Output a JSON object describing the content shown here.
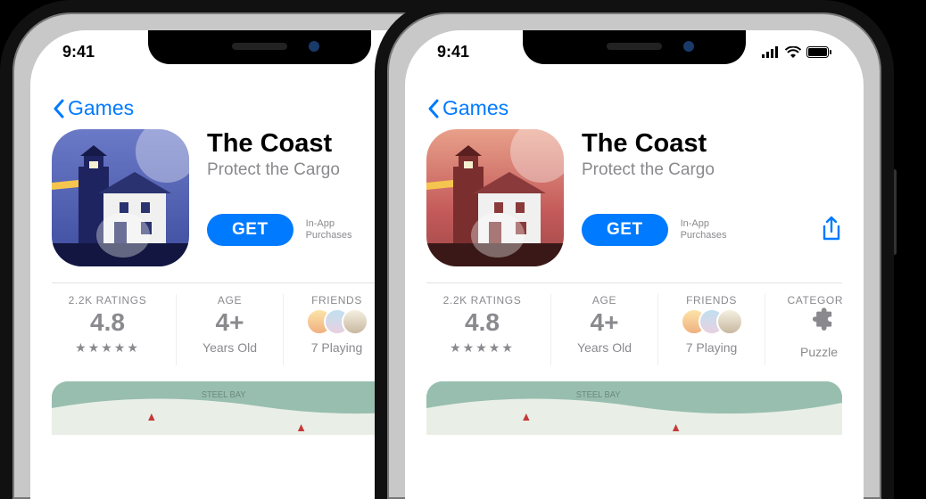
{
  "status": {
    "time": "9:41"
  },
  "nav": {
    "back_label": "Games"
  },
  "app": {
    "name": "The Coast",
    "subtitle": "Protect the Cargo",
    "get_label": "GET",
    "iap_line1": "In-App",
    "iap_line2": "Purchases"
  },
  "stats": {
    "ratings": {
      "label": "2.2K RATINGS",
      "value": "4.8"
    },
    "age": {
      "label": "AGE",
      "value": "4+",
      "sub": "Years Old"
    },
    "friends": {
      "label": "FRIENDS",
      "sub": "7 Playing"
    },
    "category": {
      "label": "CATEGORY",
      "sub": "Puzzle"
    }
  }
}
